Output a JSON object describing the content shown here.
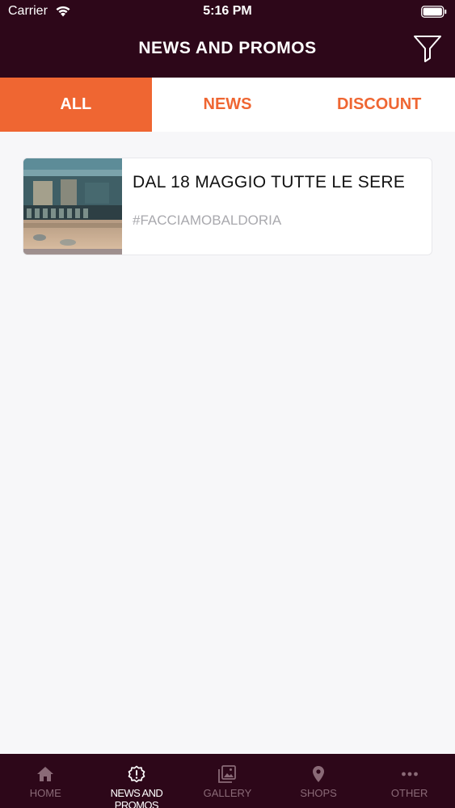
{
  "status": {
    "carrier": "Carrier",
    "time": "5:16 PM"
  },
  "header": {
    "title": "NEWS AND PROMOS",
    "filter_icon": "filter-icon"
  },
  "tabs": [
    {
      "label": "ALL",
      "active": true
    },
    {
      "label": "NEWS",
      "active": false
    },
    {
      "label": "DISCOUNT",
      "active": false
    }
  ],
  "news": [
    {
      "title": "DAL 18 MAGGIO TUTTE LE SERE",
      "subtitle": "#FACCIAMOBALDORIA"
    }
  ],
  "tab_bar": [
    {
      "label": "HOME",
      "icon": "home-icon",
      "active": false
    },
    {
      "label": "NEWS AND PROMOS",
      "icon": "news-icon",
      "active": true
    },
    {
      "label": "GALLERY",
      "icon": "gallery-icon",
      "active": false
    },
    {
      "label": "SHOPS",
      "icon": "map-pin-icon",
      "active": false
    },
    {
      "label": "OTHER",
      "icon": "more-icon",
      "active": false
    }
  ],
  "colors": {
    "brand": "#2d0719",
    "accent": "#ef6632",
    "background": "#f7f7f9"
  }
}
